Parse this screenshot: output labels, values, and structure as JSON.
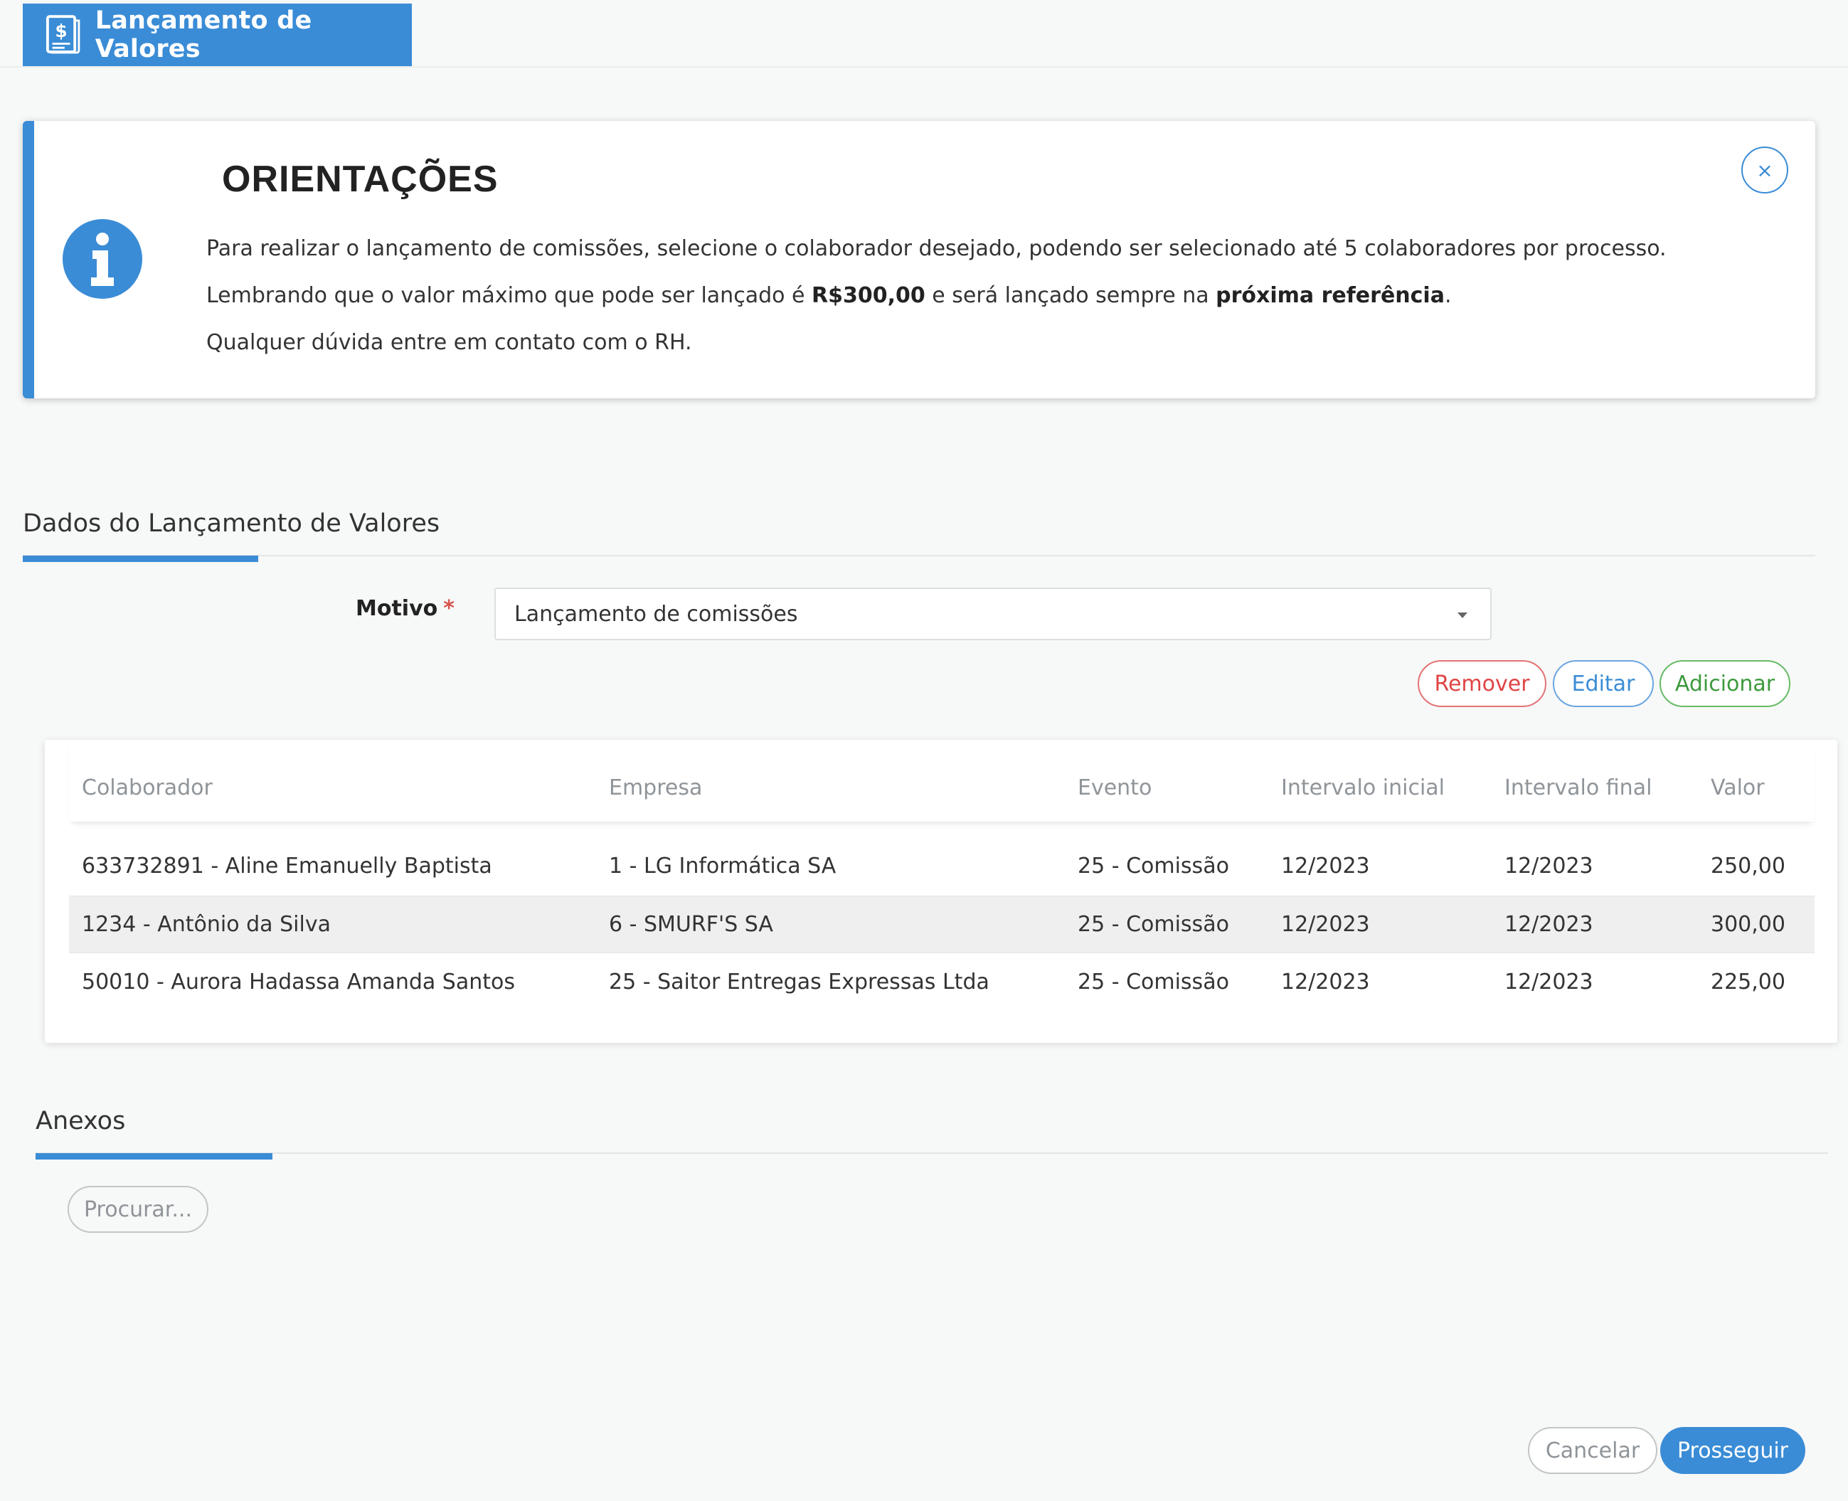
{
  "header": {
    "title": "Lançamento de Valores",
    "icon": "invoice-dollar-icon",
    "accent_color": "#3a8cd6"
  },
  "info": {
    "title": "ORIENTAÇÕES",
    "icon": "info-icon",
    "line1": "Para realizar o lançamento de comissões, selecione o colaborador desejado, podendo ser selecionado até 5 colaboradores por processo.",
    "line2_prefix": "Lembrando que o valor máximo que pode ser lançado é ",
    "line2_max_value": "R$300,00",
    "line2_middle": " e será lançado sempre na ",
    "line2_reference": "próxima referência",
    "line2_suffix": ".",
    "line3": "Qualquer dúvida entre em contato com o RH.",
    "close_label": "×"
  },
  "dados": {
    "section_title": "Dados do Lançamento de Valores",
    "motivo_label": "Motivo",
    "required_mark": "*",
    "motivo_value": "Lançamento de comissões",
    "buttons": {
      "remove": "Remover",
      "edit": "Editar",
      "add": "Adicionar"
    }
  },
  "table": {
    "columns": [
      "Colaborador",
      "Empresa",
      "Evento",
      "Intervalo inicial",
      "Intervalo final",
      "Valor"
    ],
    "rows": [
      [
        "633732891 - Aline Emanuelly Baptista",
        "1 - LG Informática SA",
        "25 - Comissão",
        "12/2023",
        "12/2023",
        "250,00"
      ],
      [
        "1234 - Antônio da Silva",
        "6 - SMURF'S SA",
        "25 - Comissão",
        "12/2023",
        "12/2023",
        "300,00"
      ],
      [
        "50010 - Aurora Hadassa Amanda Santos",
        "25 - Saitor Entregas Expressas Ltda",
        "25 - Comissão",
        "12/2023",
        "12/2023",
        "225,00"
      ]
    ]
  },
  "anexos": {
    "section_title": "Anexos",
    "browse_label": "Procurar..."
  },
  "footer": {
    "cancel_label": "Cancelar",
    "proceed_label": "Prosseguir"
  },
  "colors": {
    "primary": "#3a8cd6",
    "danger": "#e04444",
    "success": "#3d9a3d"
  }
}
